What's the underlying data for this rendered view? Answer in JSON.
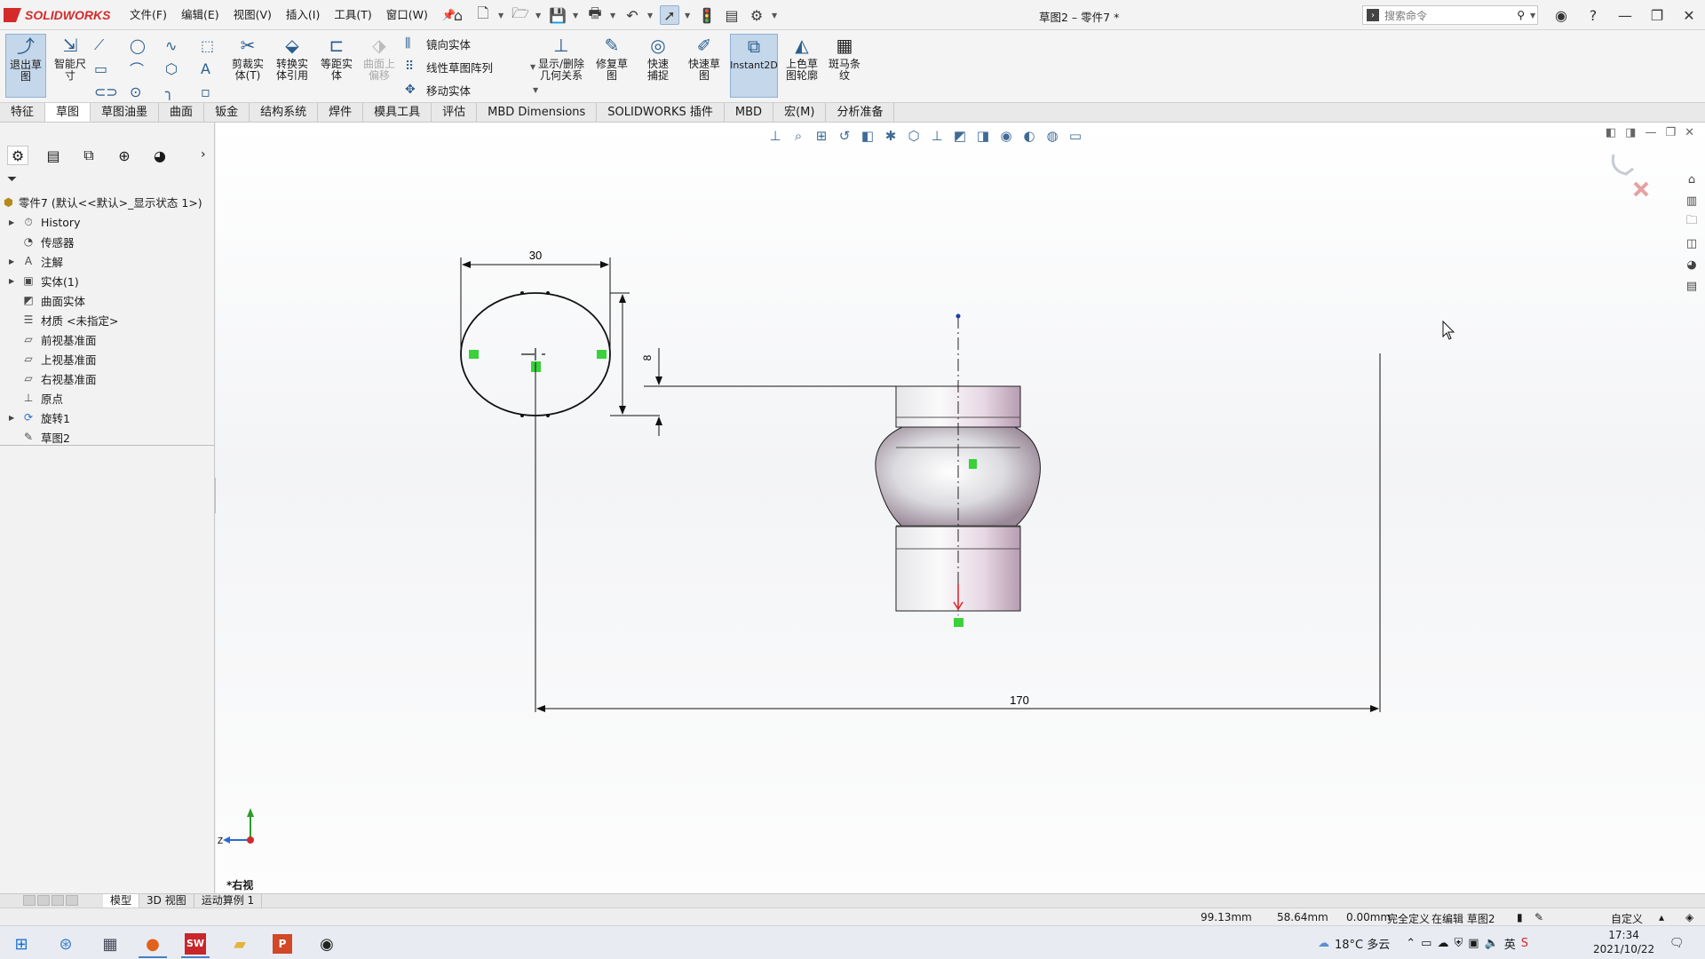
{
  "app": {
    "brand": "SOLIDWORKS",
    "doc_title": "草图2 – 零件7 *"
  },
  "menu": [
    "文件(F)",
    "编辑(E)",
    "视图(V)",
    "插入(I)",
    "工具(T)",
    "窗口(W)"
  ],
  "search": {
    "placeholder": "搜索命令"
  },
  "commands": {
    "exit_sketch": "退出草图",
    "smart_dim": "智能尺寸",
    "trim": "剪裁实体(T)",
    "convert": "转换实体引用",
    "offset": "等距实体",
    "surface_offset": "曲面上偏移",
    "mirror": "镜向实体",
    "linear_pattern": "线性草图阵列",
    "move": "移动实体",
    "display_relations": "显示/删除几何关系",
    "repair": "修复草图",
    "quick_snaps": "快速捕捉",
    "rapid_sketch": "快速草图",
    "instant2d": "Instant2D",
    "shaded_contours": "上色草图轮廓",
    "zebra": "斑马条纹"
  },
  "tabs": [
    "特征",
    "草图",
    "草图油墨",
    "曲面",
    "钣金",
    "结构系统",
    "焊件",
    "模具工具",
    "评估",
    "MBD Dimensions",
    "SOLIDWORKS 插件",
    "MBD",
    "宏(M)",
    "分析准备"
  ],
  "active_tab_index": 1,
  "tree": {
    "root": "零件7  (默认<<默认>_显示状态 1>)",
    "items": [
      {
        "label": "History",
        "icon": "history-icon",
        "expandable": true
      },
      {
        "label": "传感器",
        "icon": "sensor-icon",
        "expandable": false
      },
      {
        "label": "注解",
        "icon": "annotation-icon",
        "expandable": true
      },
      {
        "label": "实体(1)",
        "icon": "solid-body-icon",
        "expandable": true
      },
      {
        "label": "曲面实体",
        "icon": "surface-body-icon",
        "expandable": false
      },
      {
        "label": "材质 <未指定>",
        "icon": "material-icon",
        "expandable": false
      },
      {
        "label": "前视基准面",
        "icon": "plane-icon",
        "expandable": false
      },
      {
        "label": "上视基准面",
        "icon": "plane-icon",
        "expandable": false
      },
      {
        "label": "右视基准面",
        "icon": "plane-icon",
        "expandable": false
      },
      {
        "label": "原点",
        "icon": "origin-icon",
        "expandable": false
      },
      {
        "label": "旋转1",
        "icon": "revolve-icon",
        "expandable": true
      },
      {
        "label": "草图2",
        "icon": "sketch-icon",
        "expandable": false
      }
    ]
  },
  "sketch": {
    "dim_width": "30",
    "dim_height": "8",
    "dim_span": "170"
  },
  "view_label": "*右视",
  "axis_label": "Z",
  "bottom_tabs": [
    "模型",
    "3D 视图",
    "运动算例 1"
  ],
  "status": {
    "x": "99.13mm",
    "y": "58.64mm",
    "z": "0.00mm",
    "defined": "完全定义",
    "editing": "在编辑 草图2",
    "units": "自定义"
  },
  "taskbar": {
    "weather": "18°C  多云",
    "time": "17:34",
    "date": "2021/10/22"
  },
  "colors": {
    "accent": "#2a5e8f",
    "relation_green": "#3ad13a",
    "brand_red": "#d42a2a"
  }
}
